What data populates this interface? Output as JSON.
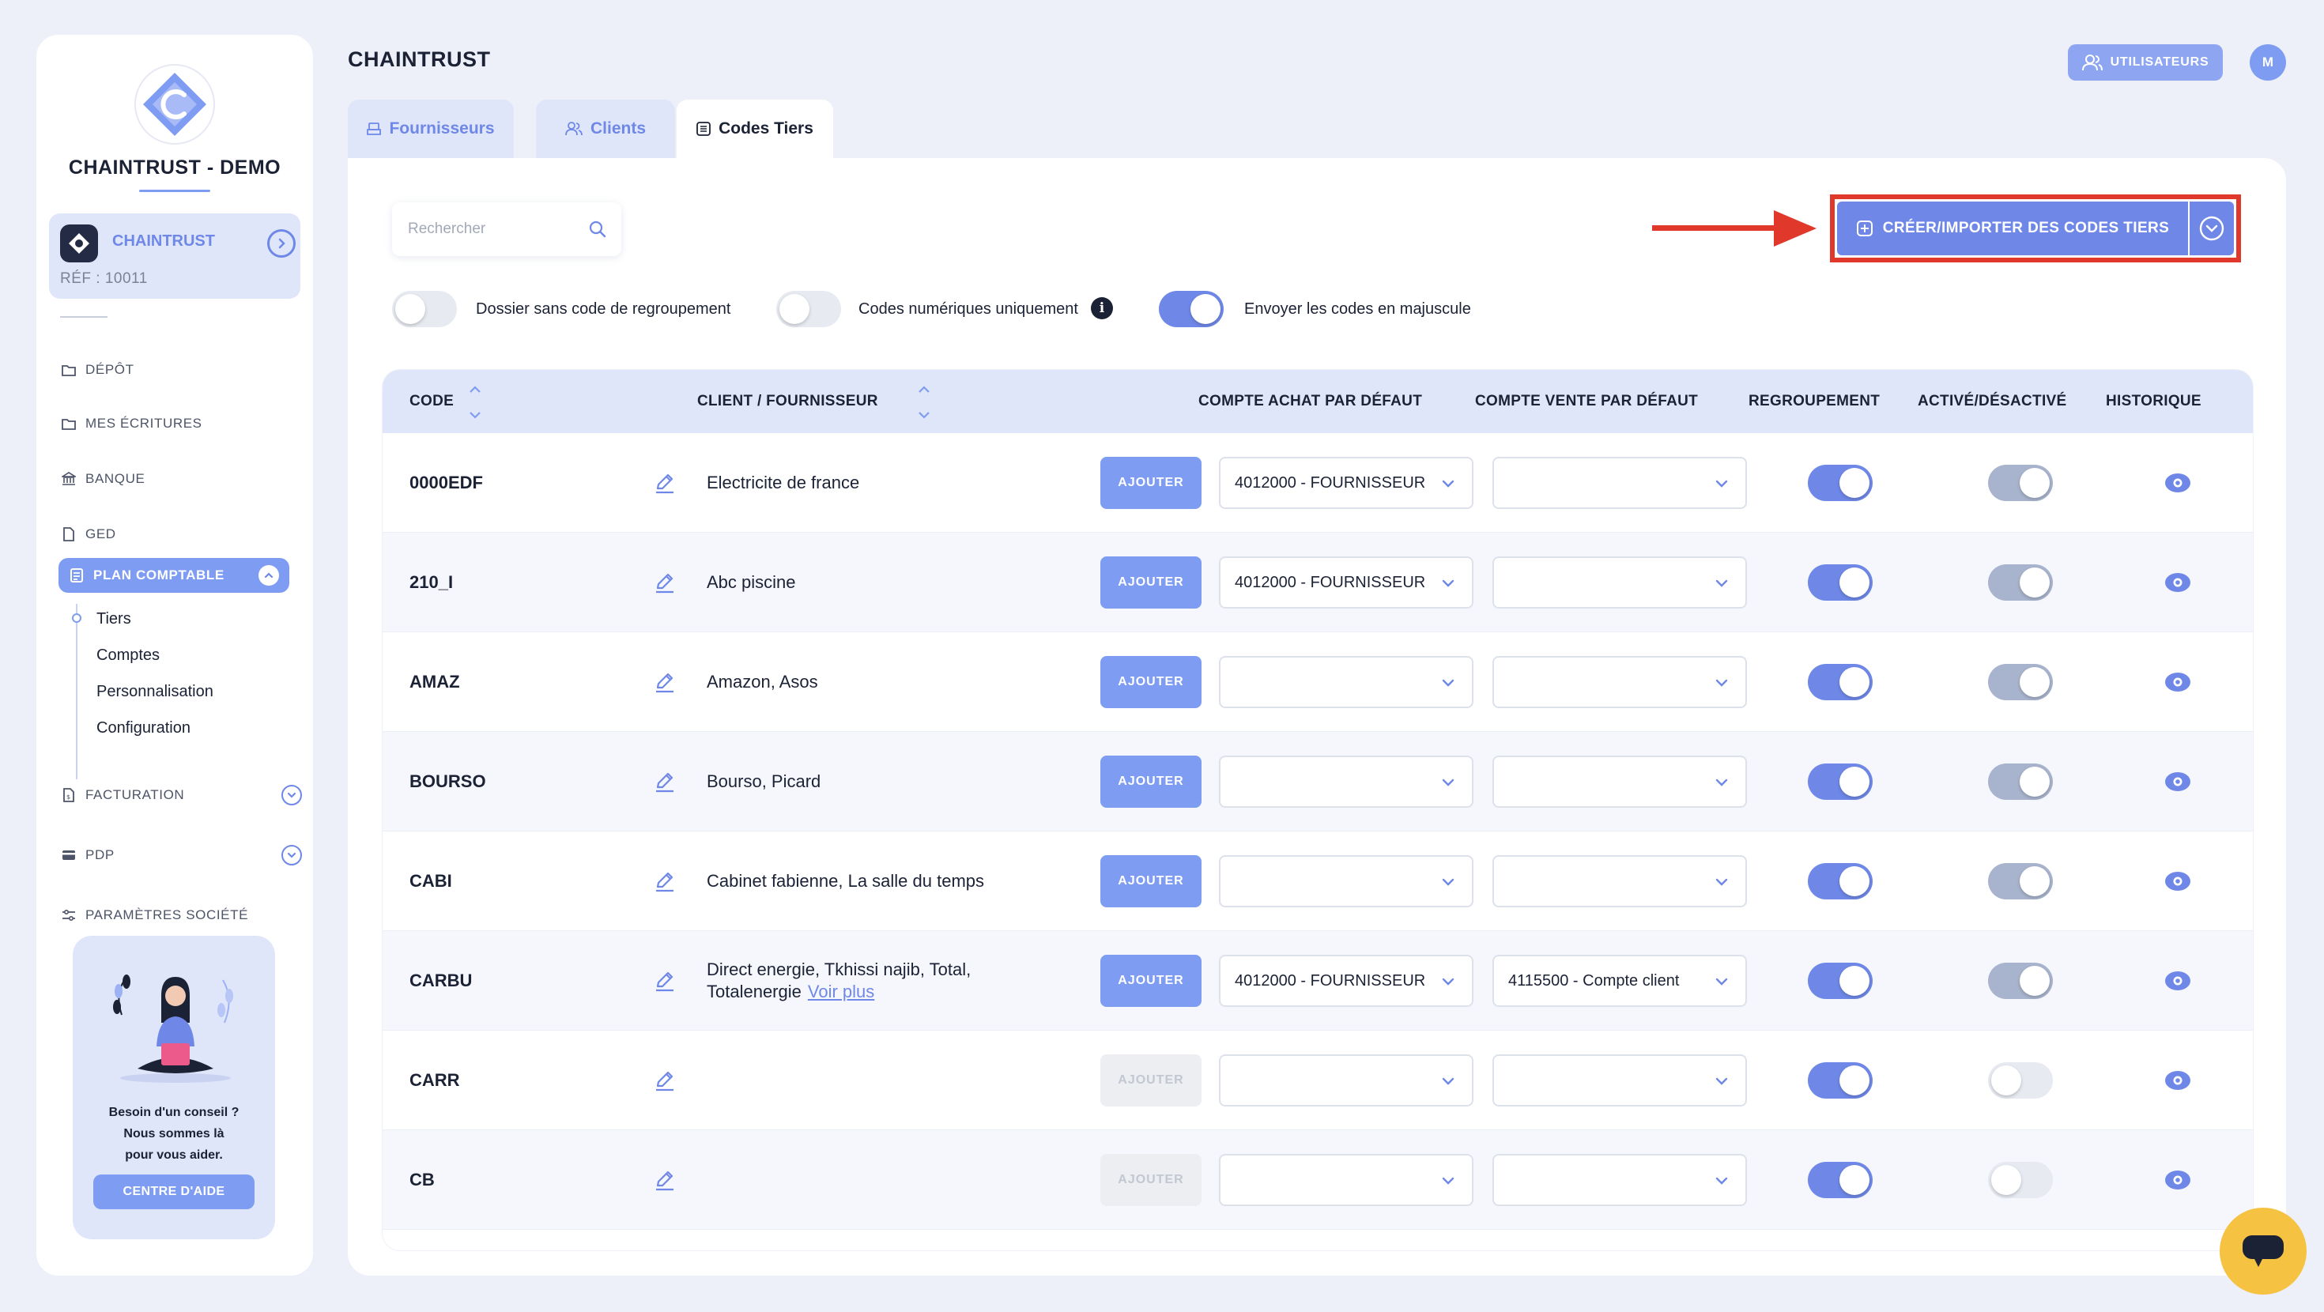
{
  "sidebar": {
    "company_name": "CHAINTRUST - DEMO",
    "org_name": "CHAINTRUST",
    "org_ref": "RÉF : 10011",
    "nav": {
      "depot": "DÉPÔT",
      "ecritures": "MES ÉCRITURES",
      "banque": "BANQUE",
      "ged": "GED",
      "plan_comptable": "PLAN COMPTABLE",
      "facturation": "FACTURATION",
      "pdp": "PDP",
      "parametres": "PARAMÈTRES SOCIÉTÉ"
    },
    "sub_items": [
      "Tiers",
      "Comptes",
      "Personnalisation",
      "Configuration"
    ],
    "help": {
      "line1": "Besoin d'un conseil ?",
      "line2": "Nous sommes là",
      "line3": "pour vous aider.",
      "button": "CENTRE D'AIDE"
    }
  },
  "header": {
    "title": "CHAINTRUST",
    "users_button": "UTILISATEURS",
    "avatar_initial": "M"
  },
  "tabs": [
    {
      "label": "Fournisseurs",
      "active": false
    },
    {
      "label": "Clients",
      "active": false
    },
    {
      "label": "Codes Tiers",
      "active": true
    }
  ],
  "toolbar": {
    "search_placeholder": "Rechercher",
    "create_button": "CRÉER/IMPORTER DES CODES TIERS",
    "toggles": [
      {
        "label": "Dossier sans code de regroupement",
        "on": false
      },
      {
        "label": "Codes numériques uniquement",
        "on": false,
        "info": "i"
      },
      {
        "label": "Envoyer les codes en majuscule",
        "on": true
      }
    ]
  },
  "table": {
    "headers": {
      "code": "CODE",
      "client": "CLIENT / FOURNISSEUR",
      "achat": "COMPTE ACHAT PAR DÉFAUT",
      "vente": "COMPTE VENTE PAR DÉFAUT",
      "regroupement": "REGROUPEMENT",
      "active": "ACTIVÉ/DÉSACTIVÉ",
      "historique": "HISTORIQUE"
    },
    "add_label": "AJOUTER",
    "see_more": "Voir plus",
    "rows": [
      {
        "code": "0000EDF",
        "client": "Electricite de france",
        "achat": "4012000 - FOURNISSEUR",
        "vente": "",
        "add_enabled": true,
        "regroupement": true,
        "active": true
      },
      {
        "code": "210_I",
        "client": "Abc piscine",
        "achat": "4012000 - FOURNISSEUR",
        "vente": "",
        "add_enabled": true,
        "regroupement": true,
        "active": true
      },
      {
        "code": "AMAZ",
        "client": "Amazon, Asos",
        "achat": "",
        "vente": "",
        "add_enabled": true,
        "regroupement": true,
        "active": true
      },
      {
        "code": "BOURSO",
        "client": "Bourso, Picard",
        "achat": "",
        "vente": "",
        "add_enabled": true,
        "regroupement": true,
        "active": true
      },
      {
        "code": "CABI",
        "client": "Cabinet fabienne, La salle du temps",
        "achat": "",
        "vente": "",
        "add_enabled": true,
        "regroupement": true,
        "active": true
      },
      {
        "code": "CARBU",
        "client": "Direct energie, Tkhissi najib, Total, Totalenergie",
        "achat": "4012000 - FOURNISSEUR",
        "vente": "4115500 - Compte client",
        "add_enabled": true,
        "regroupement": true,
        "active": true,
        "see_more": true
      },
      {
        "code": "CARR",
        "client": "",
        "achat": "",
        "vente": "",
        "add_enabled": false,
        "regroupement": true,
        "active": false
      },
      {
        "code": "CB",
        "client": "",
        "achat": "",
        "vente": "",
        "add_enabled": false,
        "regroupement": true,
        "active": false
      }
    ]
  },
  "colors": {
    "accent": "#6f88e8",
    "accent_light": "#dfe6f9",
    "annotation_red": "#e0392b",
    "chat_yellow": "#f5c242"
  }
}
